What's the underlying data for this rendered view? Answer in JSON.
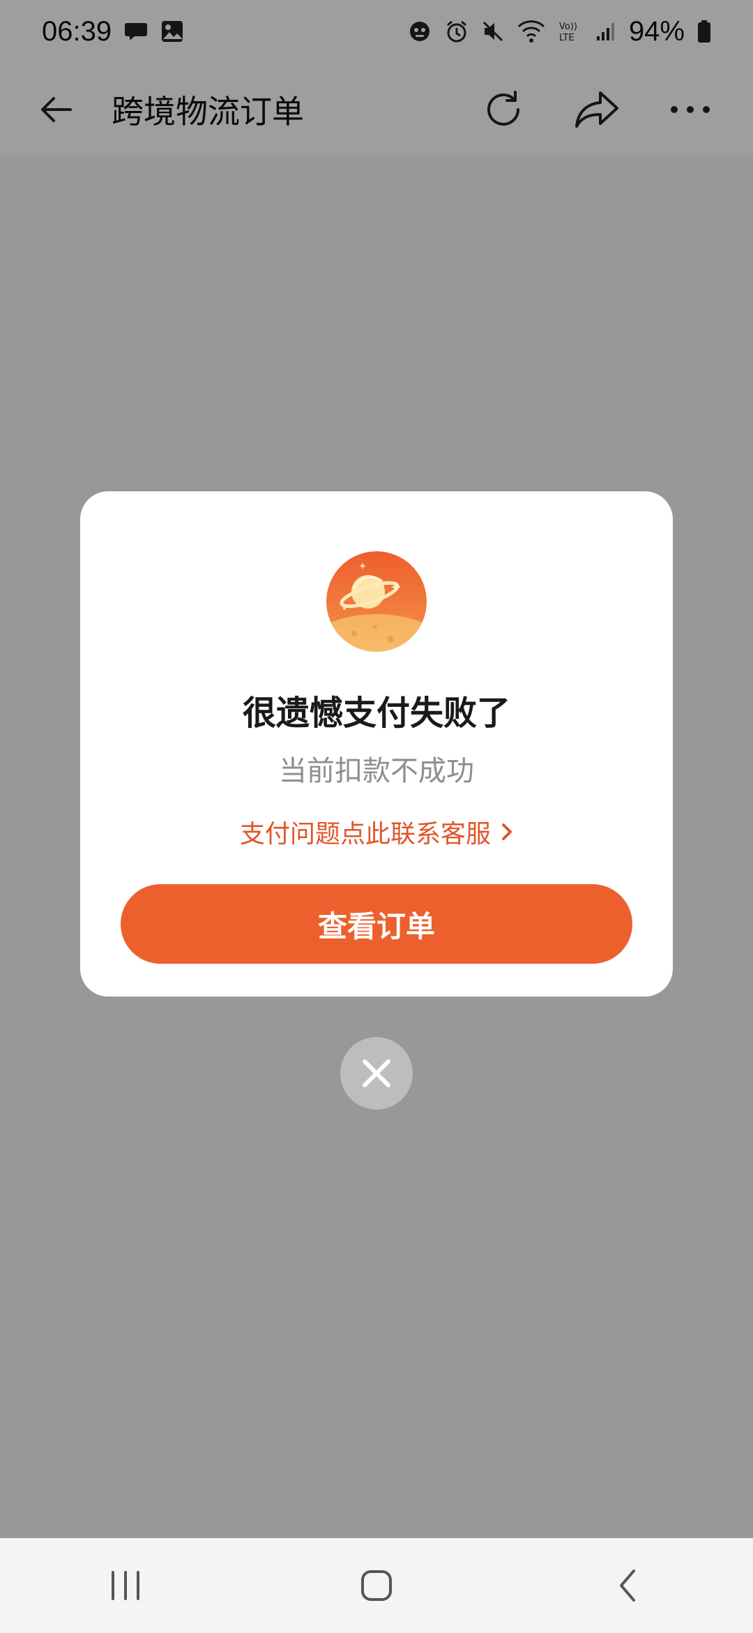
{
  "status_bar": {
    "time": "06:39",
    "battery": "94%",
    "icons_left": [
      "chat-bubble-icon",
      "image-icon"
    ],
    "icons_right": [
      "assistant-icon",
      "alarm-icon",
      "mute-icon",
      "wifi-icon",
      "volte-icon",
      "signal-icon",
      "battery-icon"
    ]
  },
  "header": {
    "title": "跨境物流订单",
    "back_icon": "arrow-left-icon",
    "actions": [
      "refresh-icon",
      "share-icon",
      "more-icon"
    ]
  },
  "modal": {
    "title": "很遗憾支付失败了",
    "subtitle": "当前扣款不成功",
    "link_text": "支付问题点此联系客服",
    "button_label": "查看订单",
    "illustration": "planet-icon"
  },
  "colors": {
    "accent": "#ec602d",
    "link": "#e2552a",
    "overlay": "rgba(0,0,0,0.38)"
  },
  "nav_bar": {
    "buttons": [
      "recent-apps-icon",
      "home-icon",
      "back-icon"
    ]
  }
}
